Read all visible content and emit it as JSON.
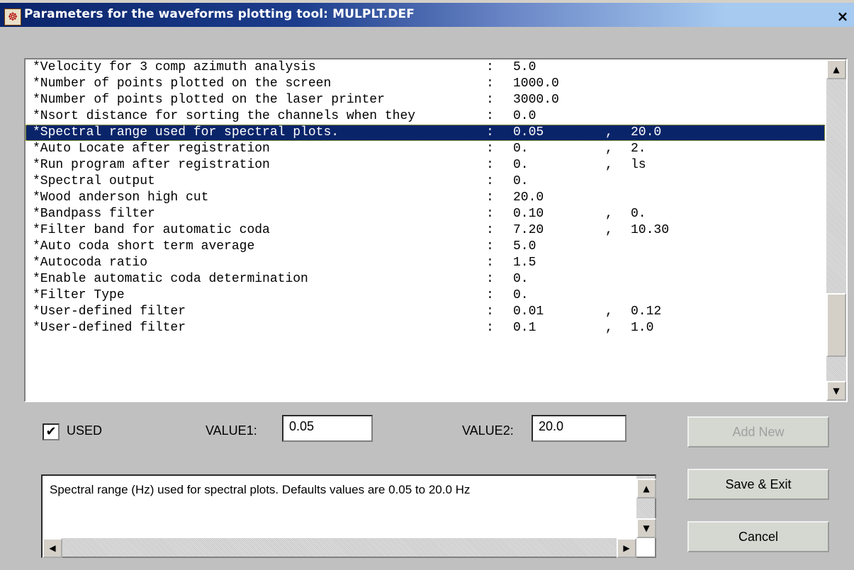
{
  "window": {
    "title": "Parameters for the waveforms plotting tool: MULPLT.DEF",
    "close": "×"
  },
  "list": {
    "rows": [
      {
        "label": "*Velocity for 3 comp azimuth analysis",
        "colon": ":",
        "v1": "5.0",
        "comma": "",
        "v2": ""
      },
      {
        "label": "*Number of points plotted on the screen",
        "colon": ":",
        "v1": "1000.0",
        "comma": "",
        "v2": ""
      },
      {
        "label": "*Number of points plotted on the laser printer",
        "colon": ":",
        "v1": "3000.0",
        "comma": "",
        "v2": ""
      },
      {
        "label": "*Nsort distance for sorting the channels when they",
        "colon": ":",
        "v1": "0.0",
        "comma": "",
        "v2": ""
      },
      {
        "label": "*Spectral range used for spectral plots.",
        "colon": ":",
        "v1": "0.05",
        "comma": ",",
        "v2": "20.0"
      },
      {
        "label": "*Auto Locate after registration",
        "colon": ":",
        "v1": "0.",
        "comma": ",",
        "v2": "2."
      },
      {
        "label": "*Run program after registration",
        "colon": ":",
        "v1": "0.",
        "comma": ",",
        "v2": "ls"
      },
      {
        "label": "*Spectral output",
        "colon": ":",
        "v1": "0.",
        "comma": "",
        "v2": ""
      },
      {
        "label": "*Wood anderson high cut",
        "colon": ":",
        "v1": "20.0",
        "comma": "",
        "v2": ""
      },
      {
        "label": "*Bandpass filter",
        "colon": ":",
        "v1": "0.10",
        "comma": ",",
        "v2": "0."
      },
      {
        "label": "*Filter band for automatic coda",
        "colon": ":",
        "v1": "7.20",
        "comma": ",",
        "v2": "10.30"
      },
      {
        "label": "*Auto coda short term average",
        "colon": ":",
        "v1": "5.0",
        "comma": "",
        "v2": ""
      },
      {
        "label": "*Autocoda ratio",
        "colon": ":",
        "v1": "1.5",
        "comma": "",
        "v2": ""
      },
      {
        "label": "*Enable automatic coda determination",
        "colon": ":",
        "v1": "0.",
        "comma": "",
        "v2": ""
      },
      {
        "label": "*Filter Type",
        "colon": ":",
        "v1": "0.",
        "comma": "",
        "v2": ""
      },
      {
        "label": "*User-defined filter",
        "colon": ":",
        "v1": "0.01",
        "comma": ",",
        "v2": "0.12"
      },
      {
        "label": "*User-defined filter",
        "colon": ":",
        "v1": "0.1",
        "comma": ",",
        "v2": "1.0"
      }
    ]
  },
  "form": {
    "used_label": "USED",
    "used_checked": "✔",
    "value1_label": "VALUE1:",
    "value1": "0.05",
    "value2_label": "VALUE2:",
    "value2": "20.0"
  },
  "buttons": {
    "add_new": "Add New",
    "save_exit": "Save & Exit",
    "cancel": "Cancel"
  },
  "description": "Spectral range (Hz) used for spectral plots. Defaults values are 0.05 to 20.0 Hz",
  "colors": {
    "selection": "#0a246a",
    "window_bg": "#c0c0c0"
  }
}
